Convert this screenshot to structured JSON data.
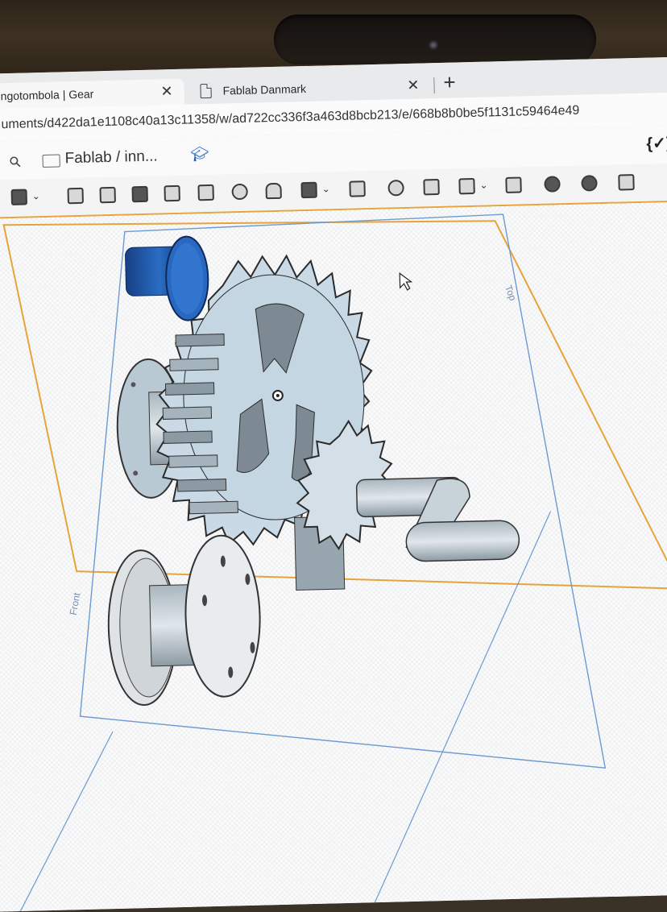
{
  "browser": {
    "tabs": [
      {
        "title": "ngotombola | Gear",
        "close": "✕"
      },
      {
        "title": "Fablab Danmark",
        "close": "✕"
      }
    ],
    "new_tab": "+",
    "url": "uments/d422da1e1108c40a13c11358/w/ad722cc336f3a463d8bcb213/e/668b8b0be5f1131c59464e49"
  },
  "app": {
    "breadcrumb": "Fablab / inn...",
    "code_button": "{✓}"
  },
  "toolbar": {
    "icons": [
      "sketch-icon",
      "extrude-icon",
      "revolve-icon",
      "sweep-icon",
      "loft-icon",
      "thicken-icon",
      "fillet-icon",
      "shell-icon",
      "pattern-icon",
      "mirror-icon",
      "boolean-icon",
      "split-icon",
      "transform-icon",
      "delete-part-icon",
      "modify-fillet-icon",
      "delete-face-icon",
      "export-icon"
    ]
  },
  "viewport": {
    "plane_labels": {
      "front": "Front",
      "top": "Top"
    },
    "colors": {
      "selected_part": "#1f5fb0",
      "part": "#c9d9e6",
      "plane_orange": "#e8a33b",
      "plane_blue": "#6d9ad0"
    }
  }
}
